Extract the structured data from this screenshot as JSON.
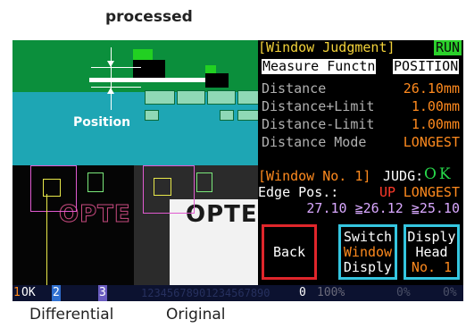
{
  "captions": {
    "processed": "processed",
    "differential": "Differential",
    "original": "Original"
  },
  "image": {
    "position_label": "Position",
    "logo_text": "OPTE"
  },
  "panel": {
    "title": "[Window Judgment]",
    "run_badge": "RUN",
    "measure_label": "Measure Functn",
    "measure_value": "POSITION",
    "rows": [
      {
        "label": "Distance",
        "value": "26.10mm"
      },
      {
        "label": "Distance+Limit",
        "value": "1.00mm"
      },
      {
        "label": "Distance-Limit",
        "value": "1.00mm"
      },
      {
        "label": "Distance Mode",
        "value": "LONGEST"
      }
    ],
    "window_no": "[Window No. 1]",
    "judg_label": "JUDG:",
    "judg_value": "OK",
    "edge_label": "Edge Pos.:",
    "edge_dir": "UP",
    "edge_mode": "LONGEST",
    "values_line": "27.10 ≧26.12 ≧25.10",
    "buttons": {
      "back": "Back",
      "switch_line1": "Switch",
      "switch_line2": "Window",
      "switch_line3": "Disply",
      "head_line1": "Disply",
      "head_line2": "Head",
      "head_line3": "No. 1"
    }
  },
  "status_strip": {
    "idx1": "1",
    "idx1_status": "OK",
    "idx2": "2",
    "idx3": "3",
    "sequence": "12345678901234567890",
    "count": "0",
    "percent1": "100%",
    "percent2": "0%",
    "percent3": "0%"
  },
  "colors": {
    "panel_gray": "#b0b0b0",
    "accent_orange": "#ff8a1e",
    "judgment_green": "#27d84a",
    "run_green": "#2bd02b",
    "back_border": "#e0262b",
    "cyan_border": "#35c6e0"
  }
}
